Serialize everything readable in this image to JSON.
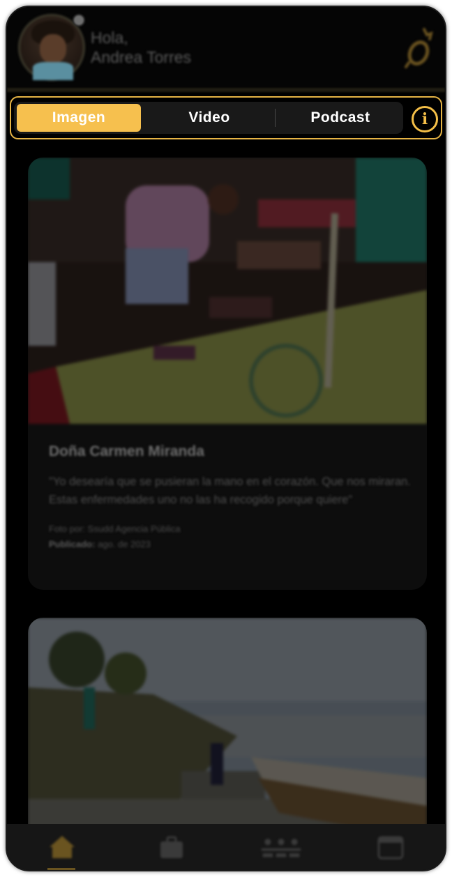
{
  "header": {
    "greeting": "Hola,",
    "user_name": "Andrea Torres",
    "avatar_icon": "user-avatar",
    "brand_icon": "brand-logo-icon"
  },
  "tabs": {
    "items": [
      {
        "label": "Imagen",
        "active": true
      },
      {
        "label": "Video",
        "active": false
      },
      {
        "label": "Podcast",
        "active": false
      }
    ],
    "info_icon": "info-icon",
    "accent_color": "#f6c04e"
  },
  "feed": {
    "cards": [
      {
        "title": "Doña Carmen Miranda",
        "quote": "\"Yo desearía que se pusieran la mano en el corazón. Que nos miraran. Estas enfermedades uno no las ha recogido porque quiere\"",
        "photo_by_label": "Foto por:",
        "photo_by": "Ssudd Agencia Pública",
        "published_label": "Publicado:",
        "published": "ago. de 2023"
      },
      {
        "title": "",
        "quote": ""
      }
    ]
  },
  "bottom_nav": {
    "items": [
      {
        "icon": "home-icon",
        "active": true
      },
      {
        "icon": "briefcase-icon",
        "active": false
      },
      {
        "icon": "community-icon",
        "active": false
      },
      {
        "icon": "calendar-icon",
        "active": false
      }
    ]
  }
}
